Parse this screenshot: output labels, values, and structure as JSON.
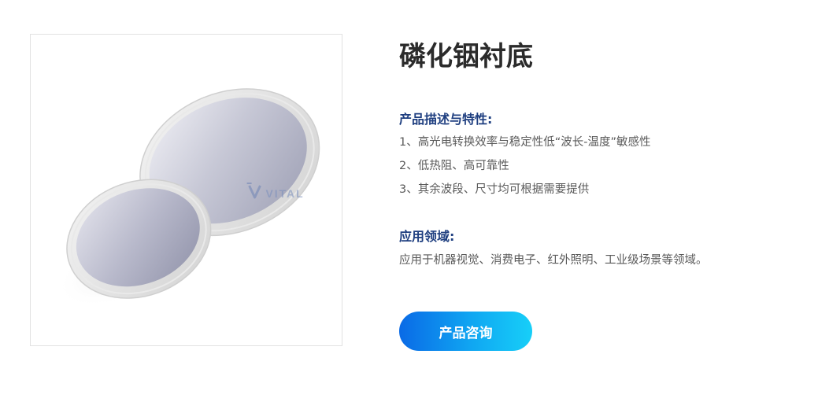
{
  "product": {
    "title": "磷化铟衬底",
    "image": {
      "watermark_text": "VITAL",
      "logo_icon": "vital-logo-icon"
    }
  },
  "description": {
    "heading": "产品描述与特性:",
    "items": [
      "1、高光电转换效率与稳定性低“波长-温度”敏感性",
      "2、低热阻、高可靠性",
      "3、其余波段、尺寸均可根据需要提供"
    ]
  },
  "application": {
    "heading": "应用领域:",
    "text": "应用于机器视觉、消费电子、红外照明、工业级场景等领域。"
  },
  "actions": {
    "consult_label": "产品咨询"
  },
  "colors": {
    "title": "#2b2b2b",
    "heading": "#1f3f80",
    "body_text": "#5a5a5a",
    "button_gradient_start": "#0a6ae6",
    "button_gradient_end": "#17cff8",
    "frame_border": "#e2e2e2"
  }
}
